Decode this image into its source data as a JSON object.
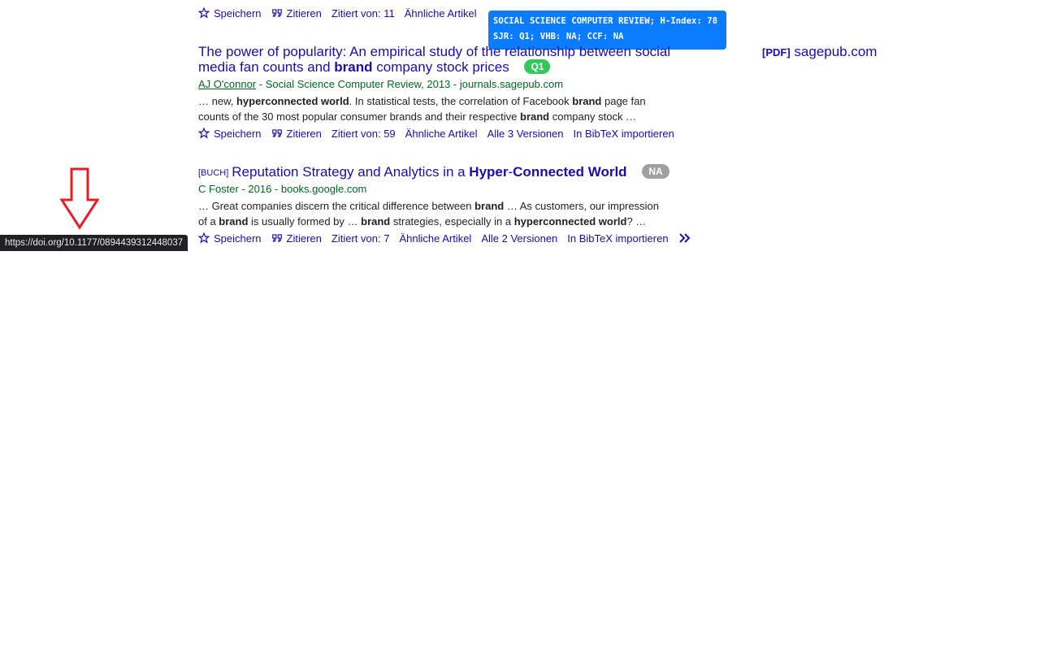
{
  "tooltip": {
    "line1": "SOCIAL SCIENCE COMPUTER REVIEW; H-Index: 78",
    "line2": "SJR: Q1; VHB: NA; CCF: NA"
  },
  "status_url": "https://doi.org/10.1177/0894439312448037",
  "colors": {
    "tooltip_bg": "#0b7cff",
    "q1_badge": "#34c759",
    "na_badge": "#a0a0a0",
    "arrow": "#e41f26",
    "link": "#1a0dab",
    "meta": "#006621"
  },
  "result0": {
    "actions": {
      "save": "Speichern",
      "cite": "Zitieren",
      "cited_by": "Zitiert von: 11",
      "related": "Ähnliche Artikel"
    }
  },
  "result1": {
    "title_part1": "The power of popularity: An empirical study of the relationship between social media fan counts and ",
    "title_bold": "brand",
    "title_part2": " company stock prices",
    "badge": "Q1",
    "author": "AJ O'connor",
    "meta_rest": " - Social Science Computer Review, 2013 - journals.sagepub.com",
    "snippet": {
      "s1": "… new, ",
      "b1": "hyperconnected world",
      "s2": ". In statistical tests, the correlation of Facebook ",
      "b2": "brand",
      "s3": " page fan counts of the 30 most popular consumer brands and their respective ",
      "b3": "brand",
      "s4": " company stock …"
    },
    "pdf": {
      "tag": "[PDF]",
      "domain": "sagepub.com"
    },
    "actions": {
      "save": "Speichern",
      "cite": "Zitieren",
      "cited_by": "Zitiert von: 59",
      "related": "Ähnliche Artikel",
      "versions": "Alle 3 Versionen",
      "bibtex": "In BibTeX importieren"
    }
  },
  "result2": {
    "type_tag": "[BUCH]",
    "title_part1": "Reputation Strategy and Analytics in a ",
    "title_bold": "Hyper",
    "title_dash": "-",
    "title_bold2": "Connected World",
    "badge": "NA",
    "meta": "C Foster - 2016 - books.google.com",
    "snippet": {
      "s1": "… Great companies discern the critical difference between ",
      "b1": "brand",
      "s2": " … As customers, our impression of a ",
      "b2": "brand",
      "s3": " is usually formed by … ",
      "b3": "brand",
      "s4": " strategies, especially in a ",
      "b4": "hyperconnected world",
      "s5": "? …"
    },
    "actions": {
      "save": "Speichern",
      "cite": "Zitieren",
      "cited_by": "Zitiert von: 7",
      "related": "Ähnliche Artikel",
      "versions": "Alle 2 Versionen",
      "bibtex": "In BibTeX importieren"
    }
  }
}
